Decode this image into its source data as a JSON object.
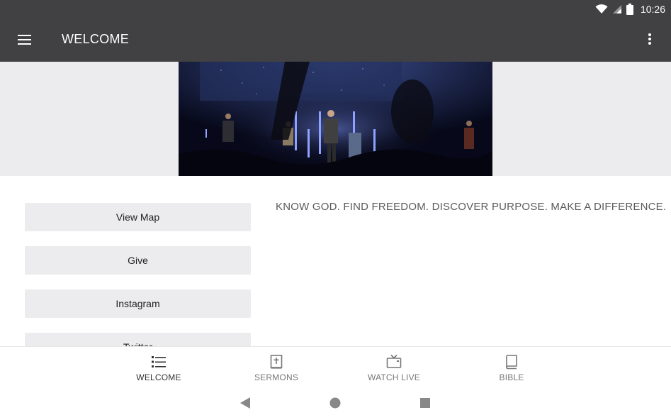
{
  "status_bar": {
    "time": "10:26",
    "icons": [
      "wifi-icon",
      "cell-signal-icon",
      "battery-icon"
    ]
  },
  "app_bar": {
    "title": "WELCOME",
    "menu_icon": "hamburger-menu-icon",
    "overflow_icon": "more-vert-icon"
  },
  "hero": {
    "image": "worship-stage-photo"
  },
  "links": [
    {
      "label": "View Map"
    },
    {
      "label": "Give"
    },
    {
      "label": "Instagram"
    },
    {
      "label": "Twitter"
    }
  ],
  "tagline": "KNOW GOD. FIND FREEDOM. DISCOVER PURPOSE. MAKE A DIFFERENCE.",
  "bottom_nav": {
    "tabs": [
      {
        "label": "WELCOME",
        "icon": "list-icon",
        "active": true
      },
      {
        "label": "SERMONS",
        "icon": "bible-cross-icon",
        "active": false
      },
      {
        "label": "WATCH LIVE",
        "icon": "tv-icon",
        "active": false
      },
      {
        "label": "BIBLE",
        "icon": "book-icon",
        "active": false
      }
    ]
  },
  "system_nav": {
    "buttons": [
      "back-icon",
      "home-icon",
      "recents-icon"
    ]
  },
  "colors": {
    "app_bar": "#414042",
    "hero_background": "#ececee",
    "button_background": "#ececee",
    "tagline_text": "#5b5b5b"
  }
}
